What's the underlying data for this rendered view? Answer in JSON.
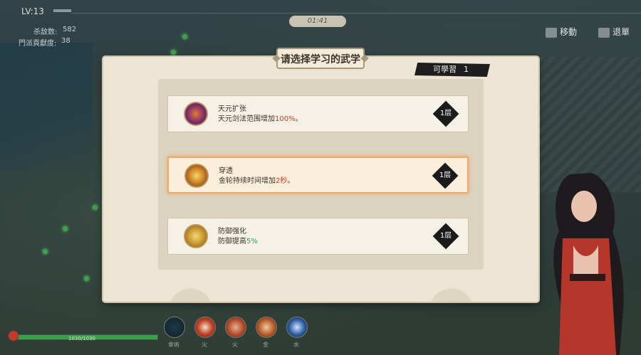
{
  "hud": {
    "level": "LV:13",
    "kills_label": "杀敌数:",
    "kills_value": "582",
    "contribution_label": "門派貢獻度:",
    "contribution_value": "38",
    "timer": "01:41",
    "move_hint": "移動",
    "exit_hint": "退單",
    "hp_text": "1030/1030",
    "hp_fraction": 1.0
  },
  "dialog": {
    "title": "请选择学习的武学",
    "learnable_label": "可學習",
    "learnable_count": "1"
  },
  "skills": [
    {
      "name": "天元扩张",
      "desc_prefix": "天元剑法范围增加",
      "highlight": "100%",
      "desc_suffix": "。",
      "highlight_color": "#c23a2a",
      "tier": "1层",
      "icon": "sword-figures-icon",
      "selected": false
    },
    {
      "name": "穿透",
      "desc_prefix": "金轮持续时间增加",
      "highlight": "2秒",
      "desc_suffix": "。",
      "highlight_color": "#c23a2a",
      "tier": "1层",
      "icon": "golden-wheel-icon",
      "selected": true
    },
    {
      "name": "防御强化",
      "desc_prefix": "防御提高",
      "highlight": "5%",
      "desc_suffix": "",
      "highlight_color": "#2f9a55",
      "tier": "1层",
      "icon": "defense-shield-icon",
      "selected": false
    }
  ],
  "skill_slots": [
    {
      "icon": "pentagram-icon",
      "label": "傘術"
    },
    {
      "icon": "fire-orb-icon",
      "label": "火"
    },
    {
      "icon": "flame-swirl-icon",
      "label": "火"
    },
    {
      "icon": "golden-wheel-slot-icon",
      "label": "金"
    },
    {
      "icon": "water-orb-icon",
      "label": "水"
    }
  ]
}
